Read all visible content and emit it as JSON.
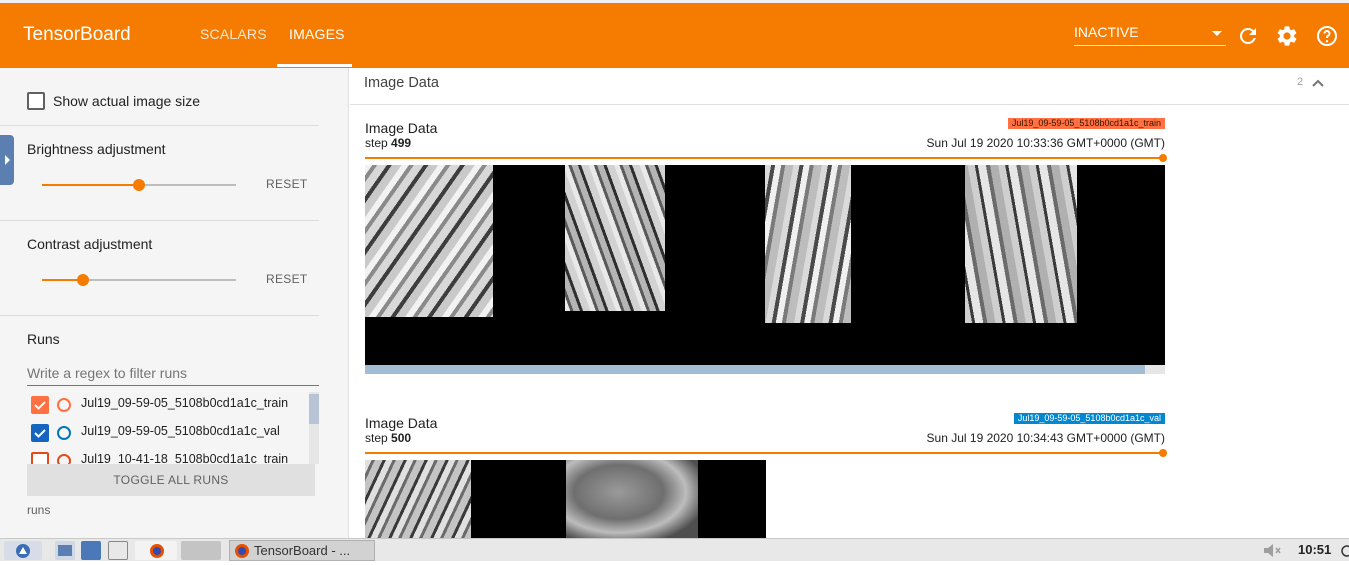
{
  "app": {
    "title": "TensorBoard"
  },
  "nav": {
    "tabs": [
      {
        "label": "SCALARS"
      },
      {
        "label": "IMAGES"
      }
    ]
  },
  "header": {
    "status_select": "INACTIVE"
  },
  "sidebar": {
    "actual_size_label": "Show actual image size",
    "brightness": {
      "label": "Brightness adjustment",
      "reset": "RESET",
      "value": 0.5
    },
    "contrast": {
      "label": "Contrast adjustment",
      "reset": "RESET",
      "value": 0.21
    },
    "runs_title": "Runs",
    "filter_placeholder": "Write a regex to filter runs",
    "runs": [
      {
        "name": "Jul19_09-59-05_5108b0cd1a1c_train",
        "checked": true,
        "color": "#ff7043"
      },
      {
        "name": "Jul19_09-59-05_5108b0cd1a1c_val",
        "checked": true,
        "color": "#0077bb"
      },
      {
        "name": "Jul19_10-41-18_5108b0cd1a1c_train",
        "checked": false,
        "color": "#e64a19"
      }
    ],
    "toggle_all": "TOGGLE ALL RUNS",
    "footer": "runs"
  },
  "main": {
    "category": {
      "title": "Image Data",
      "count": "2"
    },
    "cards": [
      {
        "title": "Image Data",
        "step_label": "step",
        "step": "499",
        "timestamp": "Sun Jul 19 2020 10:33:36 GMT+0000 (GMT)",
        "run_tag": "Jul19_09-59-05_5108b0cd1a1c_train",
        "run_color": "#ff7043"
      },
      {
        "title": "Image Data",
        "step_label": "step",
        "step": "500",
        "timestamp": "Sun Jul 19 2020 10:34:43 GMT+0000 (GMT)",
        "run_tag": "Jul19_09-59-05_5108b0cd1a1c_val",
        "run_color": "#0077bb"
      }
    ]
  },
  "taskbar": {
    "task_label": "TensorBoard - ...",
    "clock": "10:51"
  },
  "colors": {
    "accent": "#f57c00",
    "checkbox": "#ff7043",
    "checkbox_blue": "#1565c0"
  }
}
